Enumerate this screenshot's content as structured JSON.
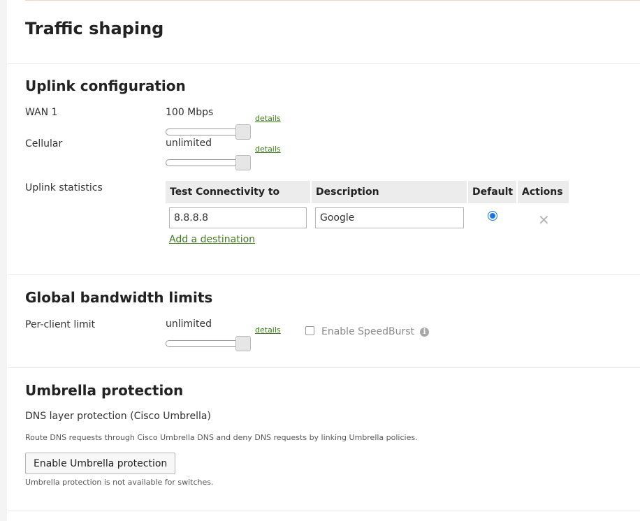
{
  "page": {
    "title": "Traffic shaping"
  },
  "uplink": {
    "title": "Uplink configuration",
    "wan1": {
      "label": "WAN 1",
      "value": "100 Mbps",
      "details": "details",
      "slider_fraction": 1.0
    },
    "cellular": {
      "label": "Cellular",
      "value": "unlimited",
      "details": "details",
      "slider_fraction": 1.0
    },
    "statistics": {
      "label": "Uplink statistics",
      "columns": [
        "Test Connectivity to",
        "Description",
        "Default",
        "Actions"
      ],
      "rows": [
        {
          "destination": "8.8.8.8",
          "description": "Google",
          "default": true,
          "action_icon": "close-icon"
        }
      ],
      "add_link": "Add a destination",
      "remove_glyph": "✕"
    }
  },
  "global_limits": {
    "title": "Global bandwidth limits",
    "per_client": {
      "label": "Per-client limit",
      "value": "unlimited",
      "details": "details",
      "slider_fraction": 1.0
    },
    "speedburst": {
      "label": "Enable SpeedBurst",
      "checked": false,
      "info_icon": "info-icon",
      "info_glyph": "i"
    }
  },
  "umbrella": {
    "title": "Umbrella protection",
    "subtitle": "DNS layer protection (Cisco Umbrella)",
    "description": "Route DNS requests through Cisco Umbrella DNS and deny DNS requests by linking Umbrella policies.",
    "button": "Enable Umbrella protection",
    "note": "Umbrella protection is not available for switches."
  },
  "colors": {
    "link": "#3f7a1f",
    "radio": "#1a73e8",
    "table_header_bg": "#ececec"
  }
}
